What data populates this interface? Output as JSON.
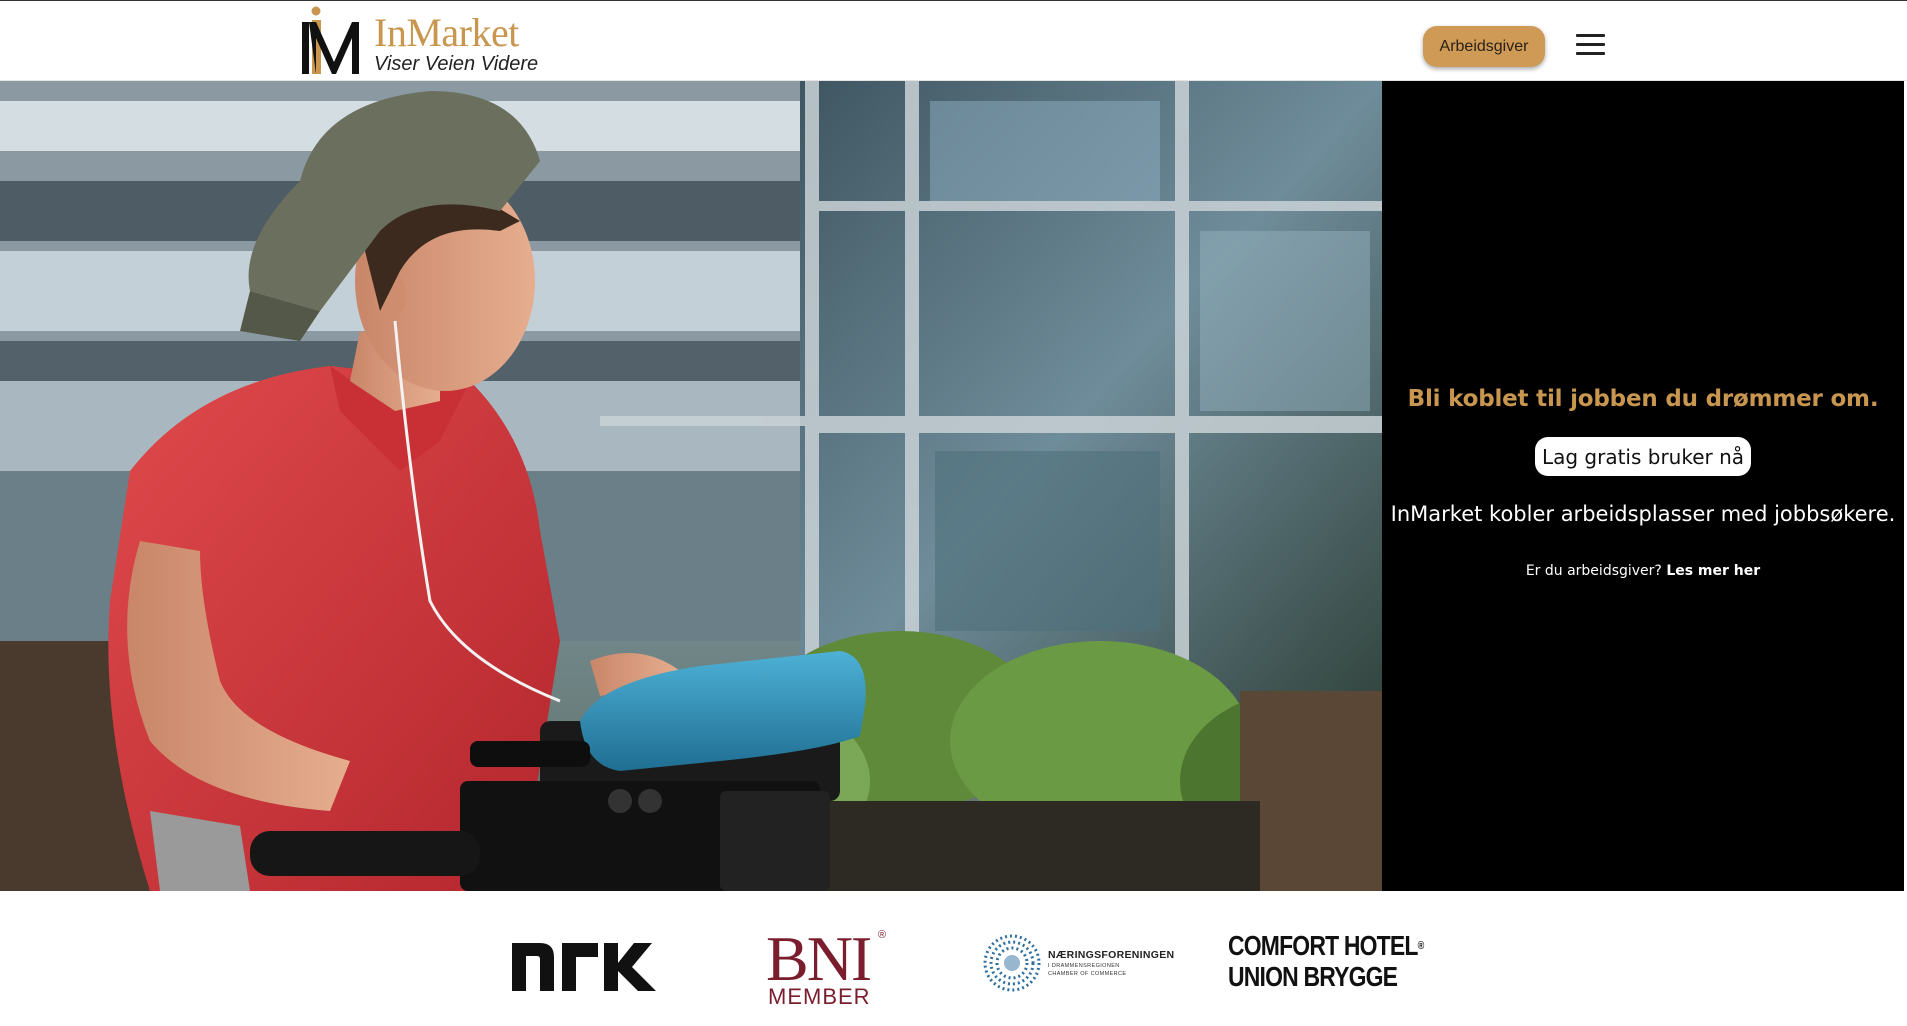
{
  "header": {
    "logo_name": "InMarket",
    "logo_tagline": "Viser Veien Videre",
    "employer_button": "Arbeidsgiver",
    "menu_icon": "hamburger-menu-icon"
  },
  "hero": {
    "image_subject": "young man in red polo shirt and cap operating a video camera with blue microphone outdoors"
  },
  "panel": {
    "heading": "Bli koblet til jobben du drømmer om.",
    "signup_button": "Lag gratis bruker nå",
    "description": "InMarket kobler arbeidsplasser med jobbsøkere.",
    "employer_prompt": "Er du arbeidsgiver?",
    "employer_link": "Les mer her"
  },
  "partners": {
    "nrk": "NRK",
    "bni": "BNI",
    "bni_member": "MEMBER",
    "bni_reg": "®",
    "naeringsforeningen": "NÆRINGSFORENINGEN",
    "naeringsforeningen_sub": "I DRAMMENSREGIONEN",
    "naeringsforeningen_sub2": "CHAMBER OF COMMERCE",
    "comfort_line1": "COMFORT HOTEL",
    "comfort_reg": "®",
    "comfort_line2": "UNION BRYGGE"
  },
  "colors": {
    "brand_gold": "#c8964f",
    "button_gold": "#cf9a55",
    "panel_black": "#000000",
    "bni_red": "#7a1e2e"
  }
}
